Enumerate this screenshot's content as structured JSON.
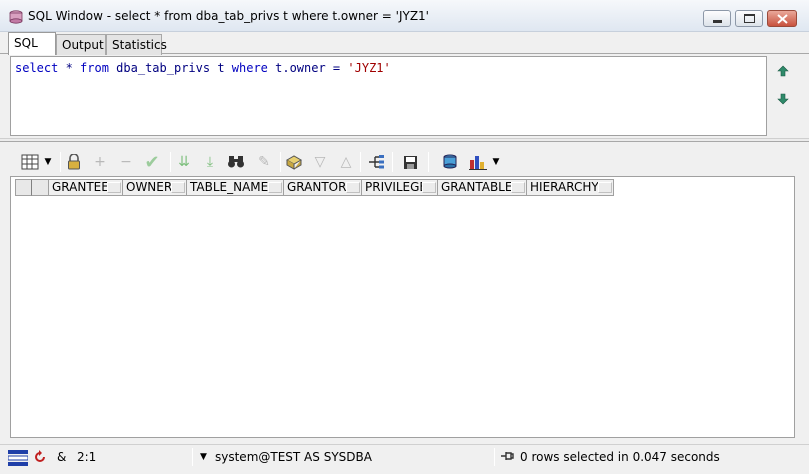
{
  "window": {
    "title": "SQL Window - select * from dba_tab_privs t where t.owner = 'JYZ1'",
    "icon": "sql-window-icon"
  },
  "tabs": [
    {
      "label": "SQL",
      "active": true
    },
    {
      "label": "Output",
      "active": false
    },
    {
      "label": "Statistics",
      "active": false
    }
  ],
  "editor": {
    "tokens": [
      {
        "text": "select",
        "kind": "kw"
      },
      {
        "text": " * ",
        "kind": "pln"
      },
      {
        "text": "from",
        "kind": "kw"
      },
      {
        "text": " dba_tab_privs t ",
        "kind": "pln"
      },
      {
        "text": "where",
        "kind": "kw"
      },
      {
        "text": " t.owner = ",
        "kind": "pln"
      },
      {
        "text": "'JYZ1'",
        "kind": "str"
      }
    ]
  },
  "grid": {
    "columns": [
      "GRANTEE",
      "OWNER",
      "TABLE_NAME",
      "GRANTOR",
      "PRIVILEGE",
      "GRANTABLE",
      "HIERARCHY"
    ],
    "rows": []
  },
  "status": {
    "position": "2:1",
    "ampersand": "&",
    "connection": "system@TEST AS SYSDBA",
    "message": "0 rows selected in 0.047 seconds"
  },
  "colors": {
    "keyword": "#0000c0",
    "string": "#a00000",
    "plain": "#000080"
  }
}
